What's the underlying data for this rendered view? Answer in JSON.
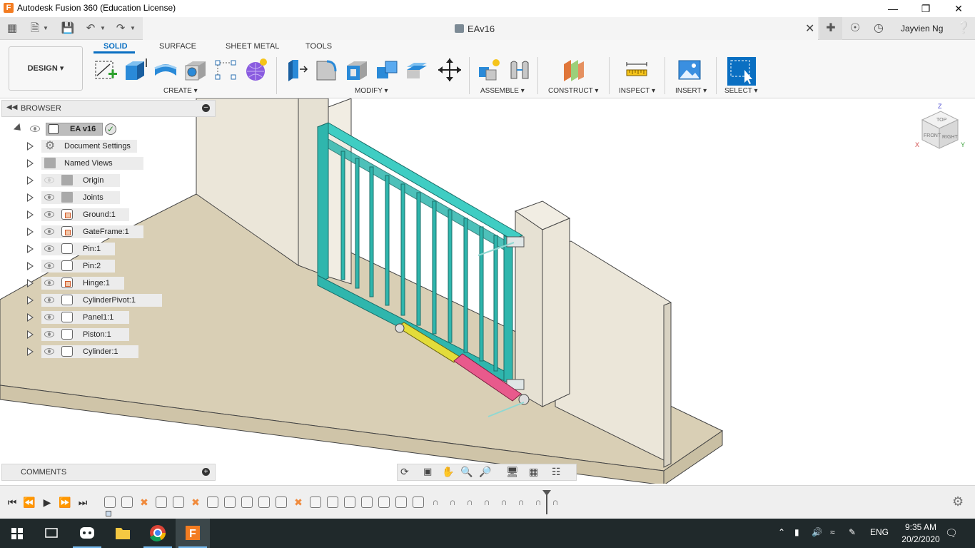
{
  "window": {
    "title": "Autodesk Fusion 360 (Education License)",
    "app_icon_letter": "F"
  },
  "document": {
    "tab_name": "EAv16",
    "user": "Jayvien Ng"
  },
  "ribbon": {
    "workspace": "DESIGN",
    "tabs": [
      "SOLID",
      "SURFACE",
      "SHEET METAL",
      "TOOLS"
    ],
    "active_tab": "SOLID",
    "groups": [
      "CREATE",
      "MODIFY",
      "ASSEMBLE",
      "CONSTRUCT",
      "INSPECT",
      "INSERT",
      "SELECT"
    ]
  },
  "browser": {
    "header": "BROWSER",
    "root": "EA v16",
    "items": [
      {
        "label": "Document Settings",
        "icon": "gear-icon",
        "visible": true
      },
      {
        "label": "Named Views",
        "icon": "folder-icon",
        "visible": true
      },
      {
        "label": "Origin",
        "icon": "folder-icon",
        "visible": false
      },
      {
        "label": "Joints",
        "icon": "folder-icon",
        "visible": true
      },
      {
        "label": "Ground:1",
        "icon": "grounded-component-icon",
        "visible": true
      },
      {
        "label": "GateFrame:1",
        "icon": "grounded-component-icon",
        "visible": true
      },
      {
        "label": "Pin:1",
        "icon": "component-icon",
        "visible": true
      },
      {
        "label": "Pin:2",
        "icon": "component-icon",
        "visible": true
      },
      {
        "label": "Hinge:1",
        "icon": "grounded-component-icon",
        "visible": true
      },
      {
        "label": "CylinderPivot:1",
        "icon": "component-icon",
        "visible": true
      },
      {
        "label": "Panel1:1",
        "icon": "component-icon",
        "visible": true
      },
      {
        "label": "Piston:1",
        "icon": "component-icon",
        "visible": true
      },
      {
        "label": "Cylinder:1",
        "icon": "component-icon",
        "visible": true
      }
    ]
  },
  "comments": {
    "header": "COMMENTS"
  },
  "viewcube": {
    "faces": [
      "TOP",
      "FRONT",
      "RIGHT"
    ],
    "axes": [
      "Z",
      "X",
      "Y"
    ]
  },
  "colors": {
    "gate": "#2fb6ad",
    "cylinder": "#e85a8c",
    "piston": "#e3dc3a",
    "floor": "#d9cfb5",
    "wall": "#ece8dd",
    "accent": "#0a6fc2"
  },
  "timeline": {
    "items": [
      "comp",
      "comp",
      "joint",
      "comp",
      "comp",
      "joint",
      "comp",
      "comp",
      "comp",
      "comp",
      "comp",
      "joint",
      "comp",
      "comp",
      "comp",
      "comp",
      "comp",
      "comp",
      "comp",
      "motion",
      "motion",
      "motion",
      "motion",
      "motion",
      "motion",
      "motion",
      "motion"
    ]
  },
  "taskbar": {
    "language": "ENG",
    "time": "9:35 AM",
    "date": "20/2/2020"
  }
}
